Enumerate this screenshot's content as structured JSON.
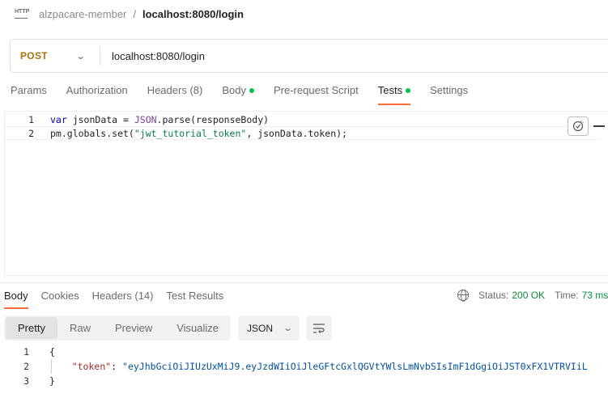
{
  "breadcrumb": {
    "icon_text": "HTTP",
    "collection": "alzpacare-member",
    "separator": "/",
    "request": "localhost:8080/login"
  },
  "request": {
    "method": "POST",
    "url": "localhost:8080/login"
  },
  "request_tabs": {
    "params": "Params",
    "authorization": "Authorization",
    "headers": "Headers",
    "headers_count": "(8)",
    "body": "Body",
    "pre_request": "Pre-request Script",
    "tests": "Tests",
    "settings": "Settings",
    "active": "Tests"
  },
  "tests_editor": {
    "lines": [
      {
        "num": "1",
        "t1": "var",
        "t2": " jsonData = ",
        "t3": "JSON",
        "t4": ".parse(responseBody)"
      },
      {
        "num": "2",
        "t1": "pm.globals.set(",
        "t2": "\"jwt_tutorial_token\"",
        "t3": ", jsonData.token);"
      }
    ]
  },
  "response_tabs": {
    "body": "Body",
    "cookies": "Cookies",
    "headers": "Headers (14)",
    "test_results": "Test Results",
    "active": "Body"
  },
  "response_status": {
    "status_label": "Status:",
    "status_value": "200 OK",
    "time_label": "Time:",
    "time_value": "73 ms"
  },
  "format_bar": {
    "pretty": "Pretty",
    "raw": "Raw",
    "preview": "Preview",
    "visualize": "Visualize",
    "active": "Pretty",
    "format": "JSON"
  },
  "response_body": {
    "lines": [
      {
        "num": "1",
        "text": "{"
      },
      {
        "num": "2",
        "key": "\"token\"",
        "sep": ": ",
        "value": "\"eyJhbGciOiJIUzUxMiJ9.eyJzdWIiOiJleGFtcGxlQGVtYWlsLmNvbSIsImF1dGgiOiJST0xFX1VTRVIiL"
      },
      {
        "num": "3",
        "text": "}"
      }
    ]
  },
  "colors": {
    "accent": "#ff6c37",
    "method_post": "#a9740f",
    "status_ok": "#0a8c3c",
    "tab_dot": "#0cbb52"
  },
  "icons": {
    "http": "http-icon",
    "method_dropdown": "chevron-down-icon",
    "snippets": "snippets-icon",
    "globe": "globe-icon",
    "format_dropdown": "chevron-down-icon",
    "wrap": "wrap-lines-icon"
  }
}
